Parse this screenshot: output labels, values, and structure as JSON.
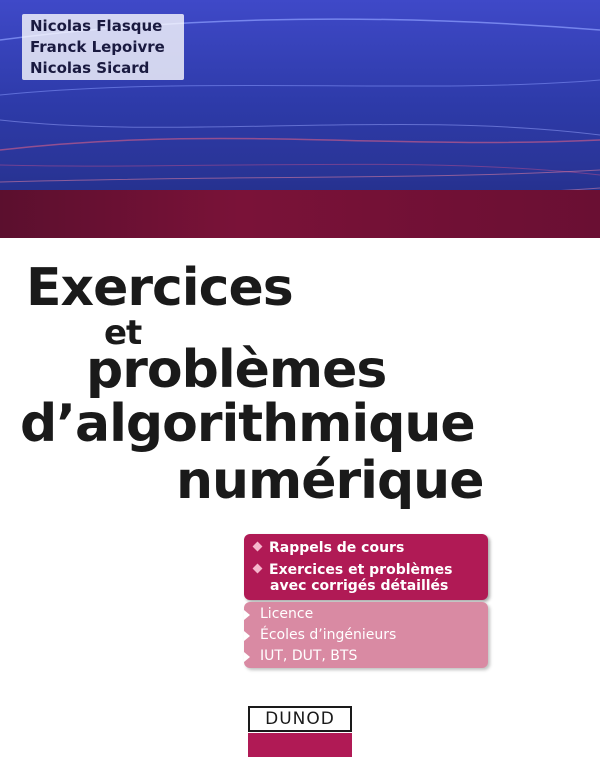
{
  "authors": [
    "Nicolas Flasque",
    "Franck Lepoivre",
    "Nicolas Sicard"
  ],
  "title": {
    "line1": "Exercices",
    "line2": "et",
    "line3": "problèmes",
    "line4": "d’algorithmique",
    "line5": "numérique"
  },
  "features": {
    "item1": "Rappels de cours",
    "item2_line1": "Exercices et problèmes",
    "item2_line2": "avec corrigés détaillés"
  },
  "levels": [
    "Licence",
    "Écoles d’ingénieurs",
    "IUT, DUT, BTS"
  ],
  "publisher": "DUNOD",
  "colors": {
    "banner_blue": "#2d3aa8",
    "band_burgundy": "#7a1238",
    "accent_magenta": "#b01a55",
    "accent_pink": "#d98aa3"
  }
}
